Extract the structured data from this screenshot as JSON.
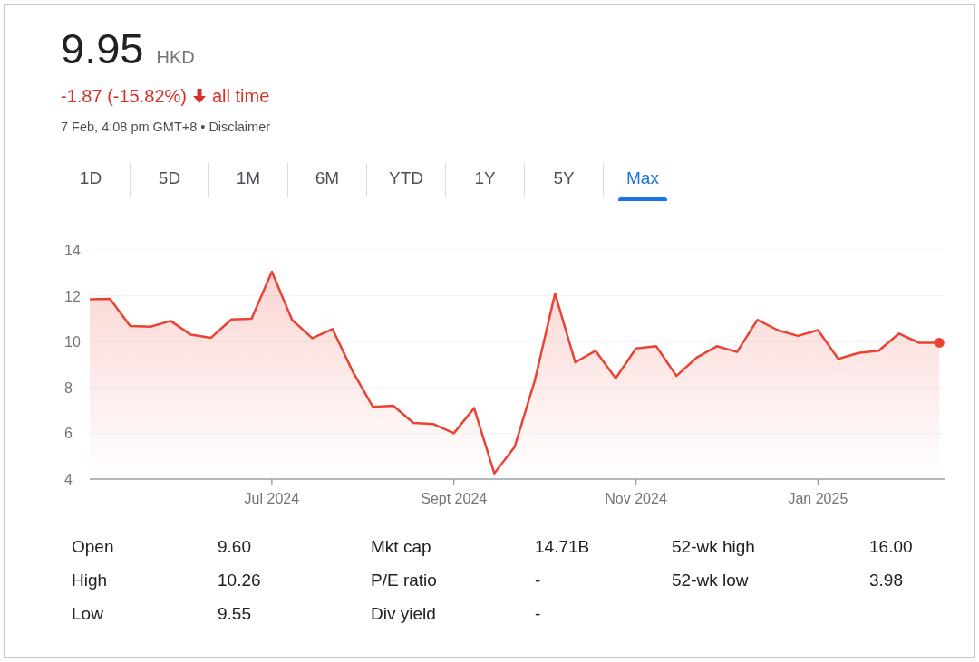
{
  "quote": {
    "price": "9.95",
    "currency": "HKD",
    "change": "-1.87 (-15.82%)",
    "falling": true,
    "period": "all time",
    "timestamp": "7 Feb, 4:08 pm GMT+8",
    "separator": "•",
    "disclaimer": "Disclaimer"
  },
  "range_tabs": [
    {
      "label": "1D",
      "selected": false
    },
    {
      "label": "5D",
      "selected": false
    },
    {
      "label": "1M",
      "selected": false
    },
    {
      "label": "6M",
      "selected": false
    },
    {
      "label": "YTD",
      "selected": false
    },
    {
      "label": "1Y",
      "selected": false
    },
    {
      "label": "5Y",
      "selected": false
    },
    {
      "label": "Max",
      "selected": true
    }
  ],
  "chart": {
    "chart_data": {
      "type": "area",
      "categories": [
        null,
        null,
        null,
        null,
        null,
        null,
        null,
        null,
        null,
        "Jul 2024",
        null,
        null,
        null,
        null,
        null,
        null,
        null,
        null,
        "Sept 2024",
        null,
        null,
        null,
        null,
        null,
        null,
        null,
        null,
        "Nov 2024",
        null,
        null,
        null,
        null,
        null,
        null,
        null,
        null,
        "Jan 2025",
        null,
        null,
        null,
        null,
        null,
        null
      ],
      "series": [
        {
          "color": "#ea4335",
          "values": [
            11.85,
            11.87,
            10.68,
            10.65,
            10.9,
            10.3,
            10.17,
            10.97,
            11.0,
            13.05,
            10.95,
            10.15,
            10.55,
            8.7,
            7.15,
            7.2,
            6.45,
            6.4,
            6.0,
            7.1,
            4.25,
            5.4,
            8.3,
            12.1,
            9.1,
            9.6,
            8.4,
            9.7,
            9.8,
            8.5,
            9.3,
            9.8,
            9.55,
            10.95,
            10.5,
            10.25,
            10.5,
            9.25,
            9.5,
            9.6,
            10.35,
            9.95,
            9.95
          ]
        }
      ],
      "ylim": [
        4,
        14
      ],
      "grid": true,
      "yticks": [
        4,
        6,
        8,
        10,
        12,
        14
      ]
    }
  },
  "stats": [
    [
      {
        "label": "Open",
        "value": "9.60"
      },
      {
        "label": "High",
        "value": "10.26"
      },
      {
        "label": "Low",
        "value": "9.55"
      }
    ],
    [
      {
        "label": "Mkt cap",
        "value": "14.71B"
      },
      {
        "label": "P/E ratio",
        "value": "-"
      },
      {
        "label": "Div yield",
        "value": "-"
      }
    ],
    [
      {
        "label": "52-wk high",
        "value": "16.00"
      },
      {
        "label": "52-wk low",
        "value": "3.98"
      }
    ]
  ]
}
